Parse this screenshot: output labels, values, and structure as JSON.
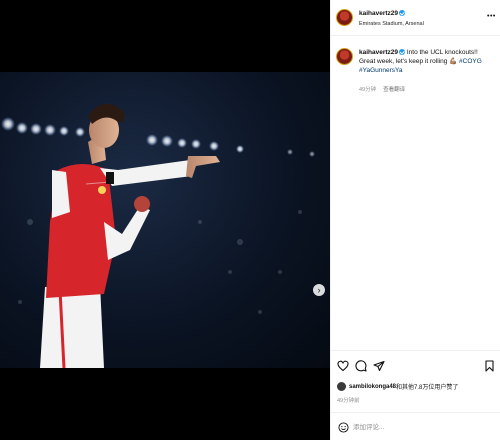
{
  "post": {
    "username": "kaihavertz29",
    "location": "Emirates Stadium, Arsenal",
    "caption_text": "Into the UCL knockouts!! Great week, let's keep it rolling 💪🏽 ",
    "hashtag_1": "#COYG",
    "hashtag_2": "#YaGunnersYa",
    "caption_time": "49分钟",
    "see_translation": "查看翻译",
    "likes_user": "sambilokonga48",
    "likes_text": "和其他7.8万位用户赞了",
    "post_time": "49分钟前",
    "comment_placeholder": "添加评论..."
  },
  "media": {
    "carousel_total": 3,
    "carousel_active": 1
  },
  "icons": {
    "verified": "verified-badge-icon",
    "more": "more-options-icon",
    "like": "heart-icon",
    "comment": "comment-icon",
    "share": "share-icon",
    "save": "bookmark-icon",
    "next": "chevron-right-icon",
    "tag": "user-tag-icon",
    "emoji": "emoji-icon"
  },
  "colors": {
    "verified": "#1d9bf0",
    "hashtag": "#00376b",
    "kit_red": "#d6262c"
  }
}
